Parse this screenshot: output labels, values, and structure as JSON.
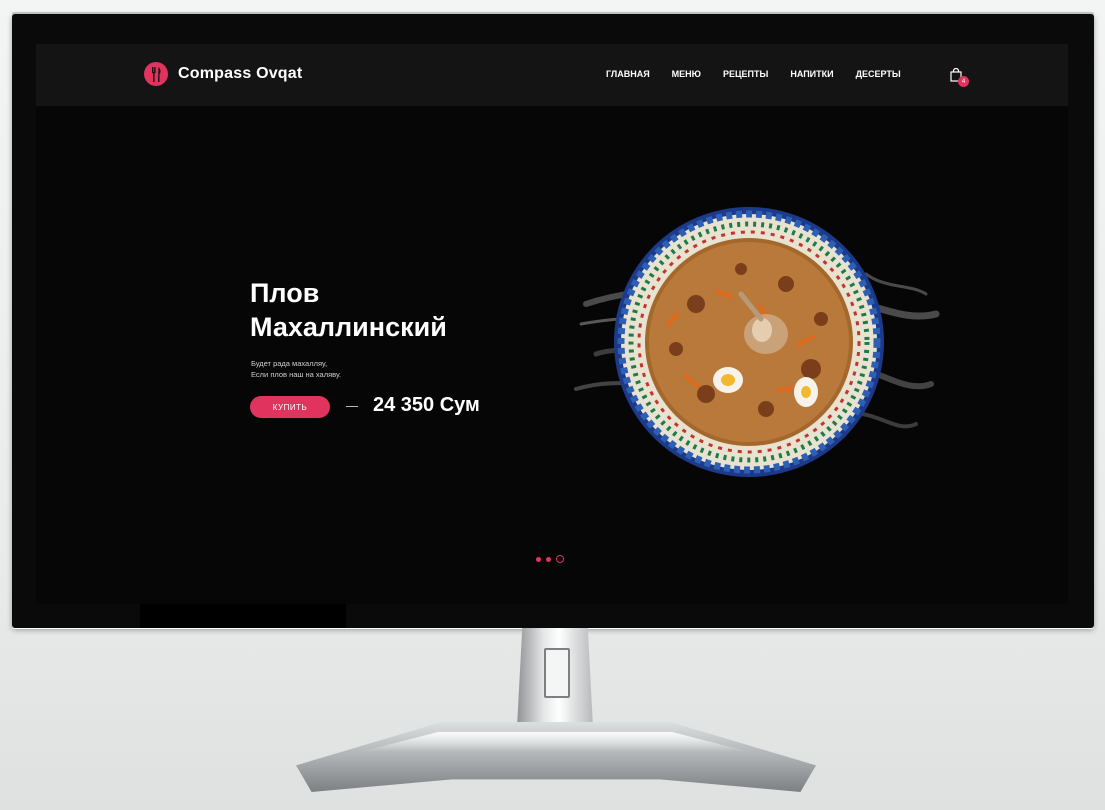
{
  "header": {
    "brand": "Compass Ovqat",
    "logo_icon": "fork-knife-icon",
    "nav": [
      {
        "label": "Главная",
        "active": true
      },
      {
        "label": "Меню",
        "active": false
      },
      {
        "label": "Рецепты",
        "active": false
      },
      {
        "label": "Напитки",
        "active": false
      },
      {
        "label": "Десерты",
        "active": false
      }
    ],
    "cart_icon": "shopping-bag-icon",
    "cart_count": "4"
  },
  "hero": {
    "title_line1": "Плов",
    "title_line2": "Махаллинский",
    "subtitle_line1": "Будет рада махалляу,",
    "subtitle_line2": "Если плов наш на халяву.",
    "buy_label": "Купить",
    "price": "24 350 Сум",
    "image": "plov-dish-image"
  },
  "slider": {
    "count": 3,
    "active_index": 2
  },
  "colors": {
    "accent": "#e0335e",
    "background": "#060606",
    "header": "#141414"
  }
}
